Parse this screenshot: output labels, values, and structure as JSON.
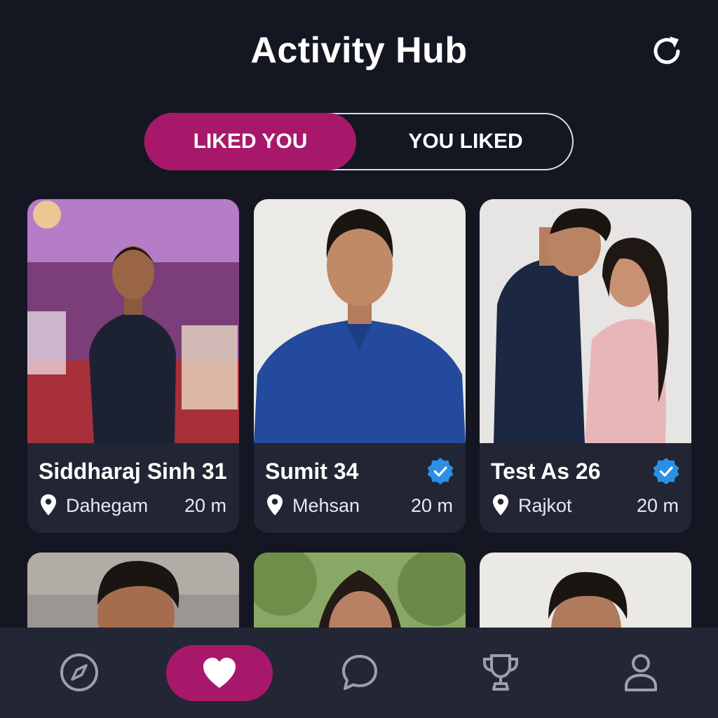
{
  "header": {
    "title": "Activity Hub",
    "refresh_icon": "refresh-icon"
  },
  "tabs": [
    {
      "label": "LIKED YOU",
      "active": true
    },
    {
      "label": "YOU LIKED",
      "active": false
    }
  ],
  "colors": {
    "background": "#141622",
    "accent": "#a8186a",
    "card": "#222533",
    "verified": "#2b8fe6",
    "nav": "#232634"
  },
  "profiles": [
    {
      "name": "Siddharaj Sinh 31",
      "city": "Dahegam",
      "distance": "20 m",
      "verified": false
    },
    {
      "name": "Sumit 34",
      "city": "Mehsan",
      "distance": "20 m",
      "verified": true
    },
    {
      "name": "Test As 26",
      "city": "Rajkot",
      "distance": "20 m",
      "verified": true
    }
  ],
  "nav": [
    {
      "icon": "compass-icon",
      "active": false
    },
    {
      "icon": "heart-icon",
      "active": true
    },
    {
      "icon": "chat-icon",
      "active": false
    },
    {
      "icon": "trophy-icon",
      "active": false
    },
    {
      "icon": "profile-icon",
      "active": false
    }
  ]
}
